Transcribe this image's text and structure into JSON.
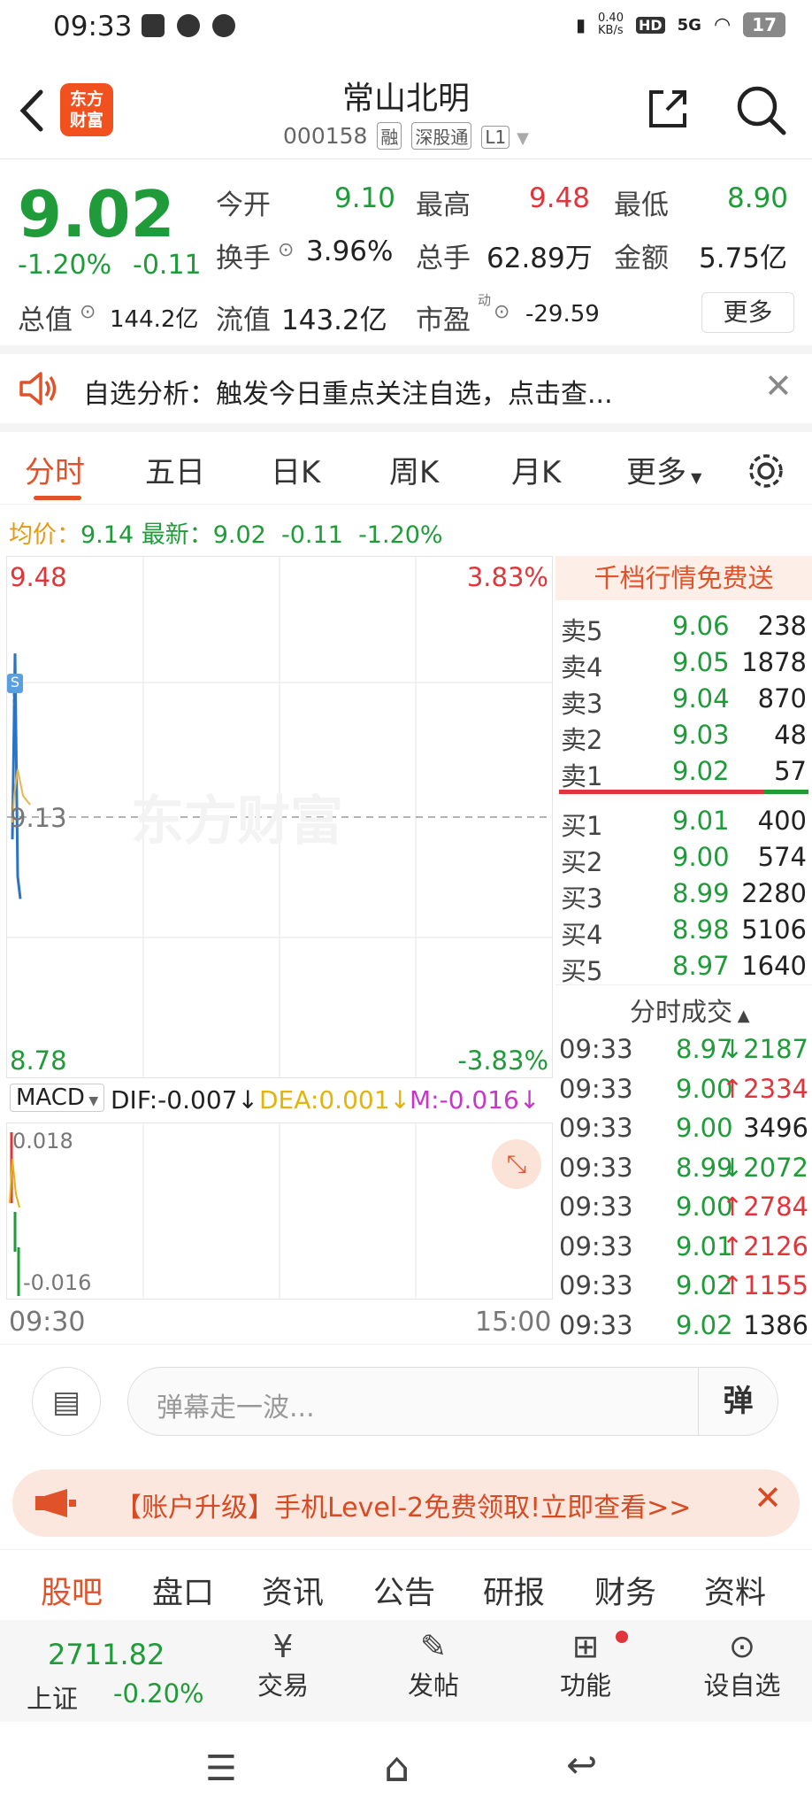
{
  "status_bar": {
    "time": "09:33",
    "net_speed": "0.40\nKB/s",
    "hd": "HD",
    "signal": "5G",
    "battery": "17"
  },
  "header": {
    "logo_text": "东方\n财富",
    "title": "常山北明",
    "code": "000158",
    "tag_rong": "融",
    "tag_sgt": "深股通",
    "tag_level": "L1"
  },
  "quote": {
    "price": "9.02",
    "change_pct": "-1.20%",
    "change": "-0.11",
    "open_label": "今开",
    "open": "9.10",
    "high_label": "最高",
    "high": "9.48",
    "low_label": "最低",
    "low": "8.90",
    "turnover_label": "换手",
    "turnover": "3.96%",
    "volume_label": "总手",
    "volume": "62.89万",
    "amount_label": "金额",
    "amount": "5.75亿",
    "mktcap_label": "总值",
    "mktcap": "144.2亿",
    "float_label": "流值",
    "float": "143.2亿",
    "pe_label": "市盈",
    "pe_sup": "动",
    "pe": "-29.59",
    "more_label": "更多"
  },
  "notice": {
    "text": "自选分析：触发今日重点关注自选，点击查..."
  },
  "chart_tabs": [
    "分时",
    "五日",
    "日K",
    "周K",
    "月K",
    "更多"
  ],
  "avg_line": {
    "avg_label": "均价：",
    "avg": "9.14",
    "latest_label": "最新：",
    "latest": "9.02",
    "chg": "-0.11",
    "pct": "-1.20%"
  },
  "chart": {
    "top_price": "9.48",
    "top_pct": "3.83%",
    "bottom_price": "8.78",
    "bottom_pct": "-3.83%",
    "mid_price": "9.13",
    "watermark": "东方财富",
    "s_marker": "S",
    "macd_label": "MACD",
    "dif": "DIF:-0.007",
    "dea": "DEA:0.001",
    "m": "M:-0.016",
    "macd_top": "0.018",
    "macd_bottom": "-0.016",
    "time_start": "09:30",
    "time_end": "15:00"
  },
  "chart_data": {
    "type": "line",
    "title": "",
    "series": [
      {
        "x": [
          "09:30",
          "09:31",
          "09:32",
          "09:33"
        ],
        "values": [
          9.1,
          9.35,
          9.05,
          9.02
        ]
      }
    ],
    "ylim": [
      8.78,
      9.48
    ]
  },
  "orderbook": {
    "header": "千档行情免费送",
    "asks": [
      {
        "label": "卖5",
        "price": "9.06",
        "vol": "238"
      },
      {
        "label": "卖4",
        "price": "9.05",
        "vol": "1878"
      },
      {
        "label": "卖3",
        "price": "9.04",
        "vol": "870"
      },
      {
        "label": "卖2",
        "price": "9.03",
        "vol": "48"
      },
      {
        "label": "卖1",
        "price": "9.02",
        "vol": "57"
      }
    ],
    "bids": [
      {
        "label": "买1",
        "price": "9.01",
        "vol": "400"
      },
      {
        "label": "买2",
        "price": "9.00",
        "vol": "574"
      },
      {
        "label": "买3",
        "price": "8.99",
        "vol": "2280"
      },
      {
        "label": "买4",
        "price": "8.98",
        "vol": "5106"
      },
      {
        "label": "买5",
        "price": "8.97",
        "vol": "1640"
      }
    ],
    "trades_title": "分时成交",
    "trades": [
      {
        "time": "09:33",
        "price": "8.97",
        "vol": "↓2187"
      },
      {
        "time": "09:33",
        "price": "9.00",
        "vol": "↑2334"
      },
      {
        "time": "09:33",
        "price": "9.00",
        "vol": "3496"
      },
      {
        "time": "09:33",
        "price": "8.99",
        "vol": "↓2072"
      },
      {
        "time": "09:33",
        "price": "9.00",
        "vol": "↑2784"
      },
      {
        "time": "09:33",
        "price": "9.01",
        "vol": "↑2126"
      },
      {
        "time": "09:33",
        "price": "9.02",
        "vol": "↑1155"
      },
      {
        "time": "09:33",
        "price": "9.02",
        "vol": "1386"
      }
    ]
  },
  "danmu": {
    "placeholder": "弹幕走一波...",
    "send_label": "弹"
  },
  "promo": {
    "text": "【账户升级】手机Level-2免费领取!立即查看>>"
  },
  "bottom_tabs": [
    "股吧",
    "盘口",
    "资讯",
    "公告",
    "研报",
    "财务",
    "资料"
  ],
  "dock": {
    "index_value": "2711.82",
    "index_name": "上证",
    "index_pct": "-0.20%",
    "trade": "交易",
    "post": "发帖",
    "func": "功能",
    "watch": "设自选"
  }
}
